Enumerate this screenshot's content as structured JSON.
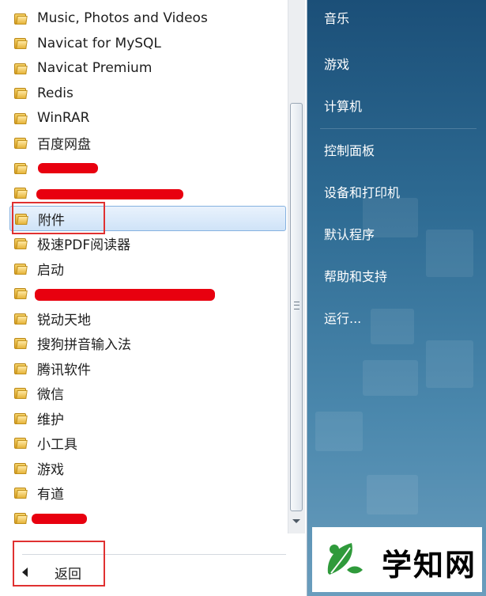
{
  "menu": {
    "items": [
      {
        "label": "Music, Photos and Videos",
        "redacted": false
      },
      {
        "label": "Navicat for MySQL",
        "redacted": false
      },
      {
        "label": "Navicat Premium",
        "redacted": false
      },
      {
        "label": "Redis",
        "redacted": false
      },
      {
        "label": "WinRAR",
        "redacted": false
      },
      {
        "label": "百度网盘",
        "redacted": false
      },
      {
        "label": "",
        "redacted": true
      },
      {
        "label": "",
        "redacted": true
      },
      {
        "label": "附件",
        "redacted": false,
        "selected": true
      },
      {
        "label": "极速PDF阅读器",
        "redacted": false
      },
      {
        "label": "启动",
        "redacted": false
      },
      {
        "label": "",
        "redacted": true
      },
      {
        "label": "锐动天地",
        "redacted": false
      },
      {
        "label": "搜狗拼音输入法",
        "redacted": false
      },
      {
        "label": "腾讯软件",
        "redacted": false
      },
      {
        "label": "微信",
        "redacted": false
      },
      {
        "label": "维护",
        "redacted": false
      },
      {
        "label": "小工具",
        "redacted": false
      },
      {
        "label": "游戏",
        "redacted": false
      },
      {
        "label": "有道",
        "redacted": false
      },
      {
        "label": "",
        "redacted": true
      }
    ],
    "back_label": "返回"
  },
  "right_panel": {
    "items": [
      "音乐",
      "游戏",
      "计算机",
      "控制面板",
      "设备和打印机",
      "默认程序",
      "帮助和支持",
      "运行..."
    ]
  },
  "watermark": {
    "text": "学知网"
  },
  "colors": {
    "highlight_box": "#e03131",
    "redaction": "#e8000f",
    "selected_bg": "#cfe3f8"
  }
}
